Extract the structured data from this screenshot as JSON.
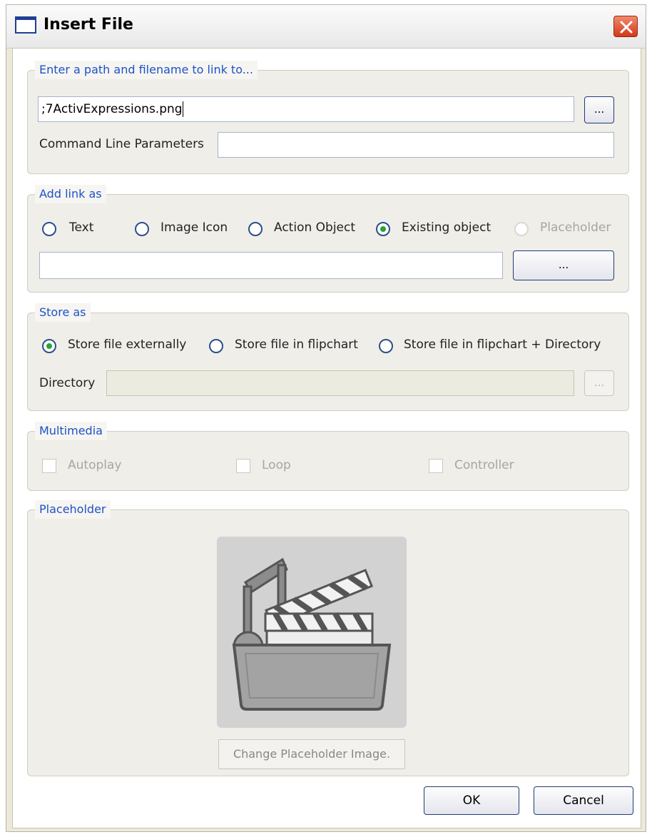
{
  "window": {
    "title": "Insert File"
  },
  "path_group": {
    "title": "Enter a path and filename to link to...",
    "path_value": ";7ActivExpressions.png",
    "browse_label": "...",
    "cmd_label": "Command Line Parameters",
    "cmd_value": ""
  },
  "link_group": {
    "title": "Add link as",
    "options": [
      {
        "label": "Text",
        "checked": false,
        "enabled": true
      },
      {
        "label": "Image Icon",
        "checked": false,
        "enabled": true
      },
      {
        "label": "Action Object",
        "checked": false,
        "enabled": true
      },
      {
        "label": "Existing object",
        "checked": true,
        "enabled": true
      },
      {
        "label": "Placeholder",
        "checked": false,
        "enabled": false
      }
    ],
    "object_value": "",
    "object_button_label": "..."
  },
  "store_group": {
    "title": "Store as",
    "options": [
      {
        "label": "Store file externally",
        "checked": true
      },
      {
        "label": "Store file in flipchart",
        "checked": false
      },
      {
        "label": "Store file in flipchart + Directory",
        "checked": false
      }
    ],
    "directory_label": "Directory",
    "directory_value": "",
    "directory_button_label": "..."
  },
  "multimedia_group": {
    "title": "Multimedia",
    "autoplay_label": "Autoplay",
    "loop_label": "Loop",
    "controller_label": "Controller"
  },
  "placeholder_group": {
    "title": "Placeholder",
    "change_button_label": "Change Placeholder Image."
  },
  "footer": {
    "ok_label": "OK",
    "cancel_label": "Cancel"
  },
  "colors": {
    "group_title": "#1d52c7",
    "radio_checked": "#27a534",
    "dialog_face": "#ece9d8"
  }
}
